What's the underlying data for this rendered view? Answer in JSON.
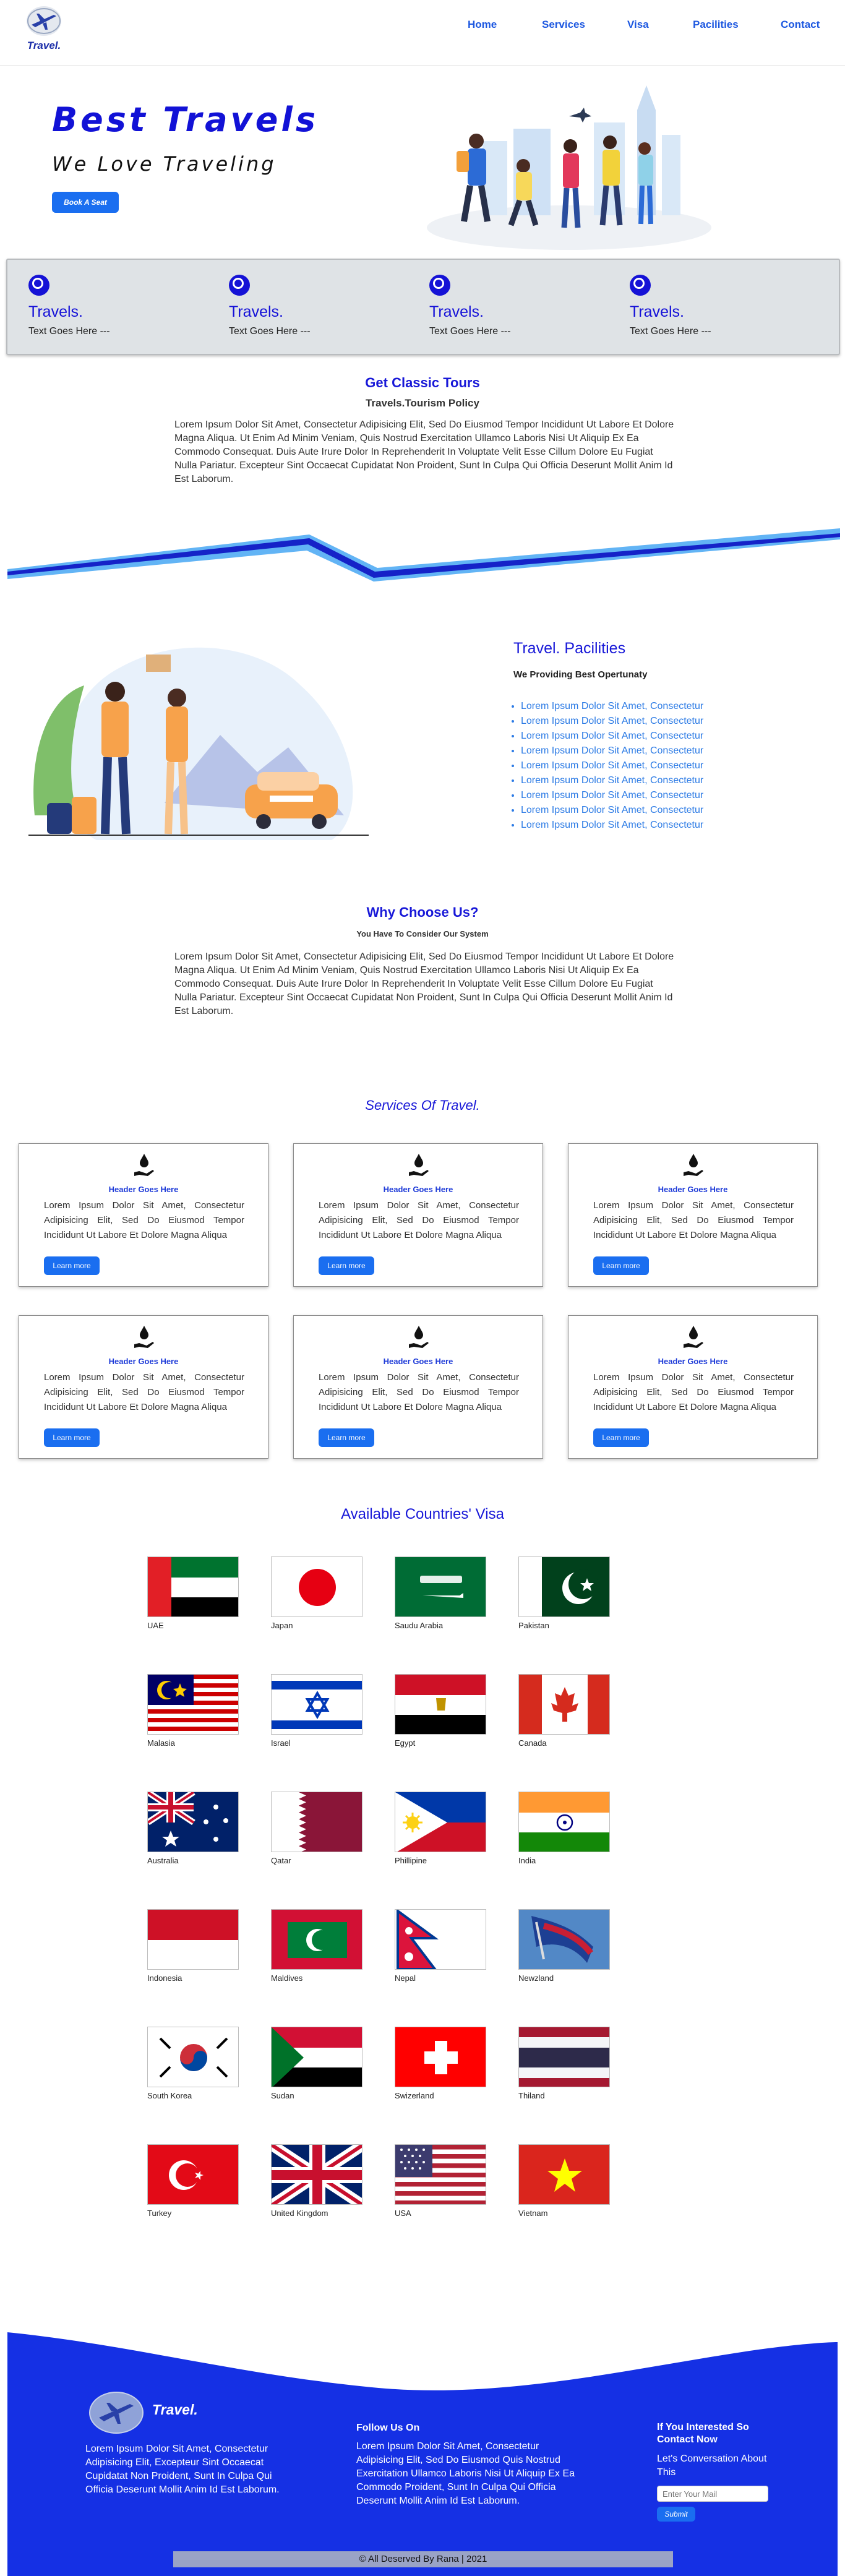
{
  "nav": {
    "logo_text": "Travel.",
    "links": [
      "Home",
      "Services",
      "Visa",
      "Pacilities",
      "Contact"
    ]
  },
  "hero": {
    "title": "Best Travels",
    "subtitle": "We Love Traveling",
    "button": "Book A Seat"
  },
  "strip": {
    "items": [
      {
        "title": "Travels.",
        "text": "Text Goes Here ---"
      },
      {
        "title": "Travels.",
        "text": "Text Goes Here ---"
      },
      {
        "title": "Travels.",
        "text": "Text Goes Here ---"
      },
      {
        "title": "Travels.",
        "text": "Text Goes Here ---"
      }
    ]
  },
  "tours": {
    "title": "Get Classic Tours",
    "subtitle": "Travels.Tourism Policy",
    "text": "Lorem Ipsum Dolor Sit Amet, Consectetur Adipisicing Elit, Sed Do Eiusmod Tempor Incididunt Ut Labore Et Dolore Magna Aliqua. Ut Enim Ad Minim Veniam, Quis Nostrud Exercitation Ullamco Laboris Nisi Ut Aliquip Ex Ea Commodo Consequat. Duis Aute Irure Dolor In Reprehenderit In Voluptate Velit Esse Cillum Dolore Eu Fugiat Nulla Pariatur. Excepteur Sint Occaecat Cupidatat Non Proident, Sunt In Culpa Qui Officia Deserunt Mollit Anim Id Est Laborum."
  },
  "facilities": {
    "title": "Travel. Pacilities",
    "subtitle": "We Providing Best Opertunaty",
    "items": [
      "Lorem Ipsum Dolor Sit Amet, Consectetur",
      "Lorem Ipsum Dolor Sit Amet, Consectetur",
      "Lorem Ipsum Dolor Sit Amet, Consectetur",
      "Lorem Ipsum Dolor Sit Amet, Consectetur",
      "Lorem Ipsum Dolor Sit Amet, Consectetur",
      "Lorem Ipsum Dolor Sit Amet, Consectetur",
      "Lorem Ipsum Dolor Sit Amet, Consectetur",
      "Lorem Ipsum Dolor Sit Amet, Consectetur",
      "Lorem Ipsum Dolor Sit Amet, Consectetur"
    ]
  },
  "why": {
    "title": "Why Choose Us?",
    "subtitle": "You Have To Consider Our System",
    "text": "Lorem Ipsum Dolor Sit Amet, Consectetur Adipisicing Elit, Sed Do Eiusmod Tempor Incididunt Ut Labore Et Dolore Magna Aliqua. Ut Enim Ad Minim Veniam, Quis Nostrud Exercitation Ullamco Laboris Nisi Ut Aliquip Ex Ea Commodo Consequat. Duis Aute Irure Dolor In Reprehenderit In Voluptate Velit Esse Cillum Dolore Eu Fugiat Nulla Pariatur. Excepteur Sint Occaecat Cupidatat Non Proident, Sunt In Culpa Qui Officia Deserunt Mollit Anim Id Est Laborum."
  },
  "services": {
    "title": "Services Of Travel.",
    "cards": [
      {
        "header": "Header Goes Here",
        "text": "Lorem Ipsum Dolor Sit Amet, Consectetur Adipisicing Elit, Sed Do Eiusmod Tempor Incididunt Ut Labore Et Dolore Magna Aliqua",
        "button": "Learn more"
      },
      {
        "header": "Header Goes Here",
        "text": "Lorem Ipsum Dolor Sit Amet, Consectetur Adipisicing Elit, Sed Do Eiusmod Tempor Incididunt Ut Labore Et Dolore Magna Aliqua",
        "button": "Learn more"
      },
      {
        "header": "Header Goes Here",
        "text": "Lorem Ipsum Dolor Sit Amet, Consectetur Adipisicing Elit, Sed Do Eiusmod Tempor Incididunt Ut Labore Et Dolore Magna Aliqua",
        "button": "Learn more"
      },
      {
        "header": "Header Goes Here",
        "text": "Lorem Ipsum Dolor Sit Amet, Consectetur Adipisicing Elit, Sed Do Eiusmod Tempor Incididunt Ut Labore Et Dolore Magna Aliqua",
        "button": "Learn more"
      },
      {
        "header": "Header Goes Here",
        "text": "Lorem Ipsum Dolor Sit Amet, Consectetur Adipisicing Elit, Sed Do Eiusmod Tempor Incididunt Ut Labore Et Dolore Magna Aliqua",
        "button": "Learn more"
      },
      {
        "header": "Header Goes Here",
        "text": "Lorem Ipsum Dolor Sit Amet, Consectetur Adipisicing Elit, Sed Do Eiusmod Tempor Incididunt Ut Labore Et Dolore Magna Aliqua",
        "button": "Learn more"
      }
    ]
  },
  "visa": {
    "title": "Available Countries' Visa",
    "countries": [
      "UAE",
      "Japan",
      "Saudu Arabia",
      "Pakistan",
      "Malasia",
      "Israel",
      "Egypt",
      "Canada",
      "Australia",
      "Qatar",
      "Phillipine",
      "India",
      "Indonesia",
      "Maldives",
      "Nepal",
      "Newzland",
      "South Korea",
      "Sudan",
      "Swizerland",
      "Thiland",
      "Turkey",
      "United Kingdom",
      "USA",
      "Vietnam"
    ]
  },
  "footer": {
    "logo_text": "Travel.",
    "about": "Lorem Ipsum Dolor Sit Amet, Consectetur Adipisicing Elit, Excepteur Sint Occaecat Cupidatat Non Proident, Sunt In Culpa Qui Officia Deserunt Mollit Anim Id Est Laborum.",
    "follow_title": "Follow Us On",
    "follow_text": "Lorem Ipsum Dolor Sit Amet, Consectetur Adipisicing Elit, Sed Do Eiusmod Quis Nostrud Exercitation Ullamco Laboris Nisi Ut Aliquip Ex Ea Commodo Proident, Sunt In Culpa Qui Officia Deserunt Mollit Anim Id Est Laborum.",
    "contact_title": "If You Interested So Contact Now",
    "contact_text": "Let's Conversation About This",
    "mail_placeholder": "Enter Your Mail",
    "submit": "Submit",
    "copyright": "© All Deserved By Rana | 2021"
  },
  "colors": {
    "primary_blue": "#1818d8",
    "button_blue": "#1a6ef0",
    "footer_blue": "#1530e4",
    "wave_light": "#62b4f5",
    "wave_dark": "#1522c8"
  }
}
